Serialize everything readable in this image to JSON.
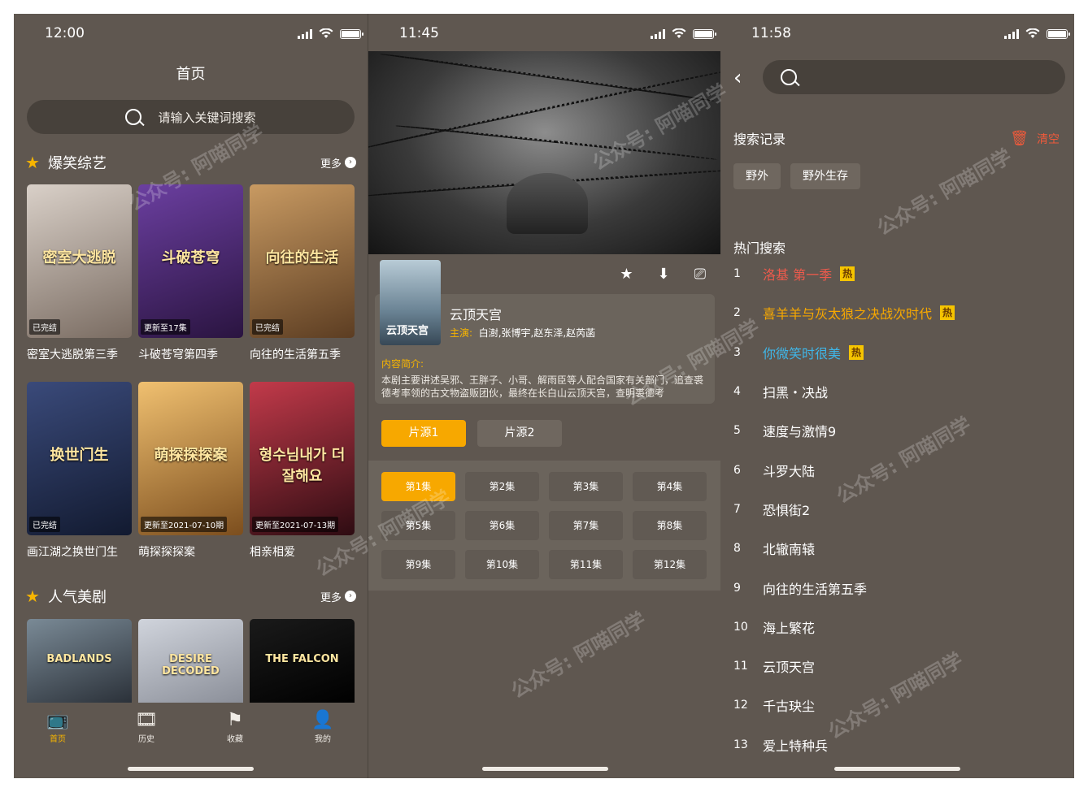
{
  "colors": {
    "bg": "#5f5750",
    "accent": "#f7b500",
    "hot_red": "#ef5a4c",
    "hot_orange": "#f7a800",
    "hot_blue": "#3fb6e8"
  },
  "panel1": {
    "time": "12:00",
    "title": "首页",
    "search_placeholder": "请输入关键词搜索",
    "section1": {
      "name": "爆笑综艺",
      "more": "更多"
    },
    "section2": {
      "name": "人气美剧",
      "more": "更多"
    },
    "cards": [
      {
        "title": "密室大逃脱第三季",
        "badge": "已完结",
        "poster_text": "密室大逃脱",
        "color1": "#d9d0c8",
        "color2": "#7a6c62"
      },
      {
        "title": "斗破苍穹第四季",
        "badge": "更新至17集",
        "poster_text": "斗破苍穹",
        "color1": "#6b3fa0",
        "color2": "#2a1440"
      },
      {
        "title": "向往的生活第五季",
        "badge": "已完结",
        "poster_text": "向往的生活",
        "color1": "#c89a62",
        "color2": "#5c3d22"
      },
      {
        "title": "画江湖之换世门生",
        "badge": "已完结",
        "poster_text": "换世门生",
        "color1": "#3a4a7a",
        "color2": "#121a30"
      },
      {
        "title": "萌探探探案",
        "badge": "更新至2021-07-10期",
        "poster_text": "萌探探探案",
        "color1": "#f0c070",
        "color2": "#7c4e1e"
      },
      {
        "title": "相亲相爱",
        "badge": "更新至2021-07-13期",
        "poster_text": "형수님내가 더잘해요",
        "color1": "#c23a4a",
        "color2": "#2e0c12"
      }
    ],
    "cards2": [
      {
        "poster_text": "BADLANDS",
        "color1": "#7a8a96",
        "color2": "#2a3038"
      },
      {
        "poster_text": "DESIRE DECODED",
        "color1": "#d0d4dc",
        "color2": "#8a8e98"
      },
      {
        "poster_text": "THE FALCON",
        "color1": "#1a1a1a",
        "color2": "#000000"
      }
    ],
    "tabs": [
      {
        "label": "首页",
        "icon": "tv-icon",
        "glyph": "📺"
      },
      {
        "label": "历史",
        "icon": "film-icon",
        "glyph": "🎞"
      },
      {
        "label": "收藏",
        "icon": "flag-icon",
        "glyph": "⚑"
      },
      {
        "label": "我的",
        "icon": "user-icon",
        "glyph": "👤"
      }
    ]
  },
  "panel2": {
    "time": "11:45",
    "drama_title": "云顶天宫",
    "cover_text": "云顶天宫",
    "cast_label": "主演:",
    "cast": "白澍,张博宇,赵东泽,赵芮菡",
    "intro_label": "内容简介:",
    "intro": "本剧主要讲述吴邪、王胖子、小哥、解雨臣等人配合国家有关部门，追查裘德考率领的古文物盗贩团伙，最终在长白山云顶天宫，查明裘德考",
    "sources": [
      "片源1",
      "片源2"
    ],
    "episodes": [
      "第1集",
      "第2集",
      "第3集",
      "第4集",
      "第5集",
      "第6集",
      "第7集",
      "第8集",
      "第9集",
      "第10集",
      "第11集",
      "第12集"
    ],
    "actions": [
      {
        "name": "favorite-star-icon",
        "glyph": "★"
      },
      {
        "name": "download-icon",
        "glyph": "⬇"
      },
      {
        "name": "cast-screen-icon",
        "glyph": "⎚"
      }
    ]
  },
  "panel3": {
    "time": "11:58",
    "history_title": "搜索记录",
    "clear_label": "清空",
    "history": [
      "野外",
      "野外生存"
    ],
    "hot_title": "热门搜索",
    "hot_badge": "热",
    "hot": [
      {
        "rank": "1",
        "name": "洛基 第一季",
        "hot": true,
        "color": "#ef5a4c"
      },
      {
        "rank": "2",
        "name": "喜羊羊与灰太狼之决战次时代",
        "hot": true,
        "color": "#f7a800"
      },
      {
        "rank": "3",
        "name": "你微笑时很美",
        "hot": true,
        "color": "#3fb6e8"
      },
      {
        "rank": "4",
        "name": "扫黑・决战",
        "hot": false,
        "color": "#ffffff"
      },
      {
        "rank": "5",
        "name": "速度与激情9",
        "hot": false,
        "color": "#ffffff"
      },
      {
        "rank": "6",
        "name": "斗罗大陆",
        "hot": false,
        "color": "#ffffff"
      },
      {
        "rank": "7",
        "name": "恐惧街2",
        "hot": false,
        "color": "#ffffff"
      },
      {
        "rank": "8",
        "name": "北辙南辕",
        "hot": false,
        "color": "#ffffff"
      },
      {
        "rank": "9",
        "name": "向往的生活第五季",
        "hot": false,
        "color": "#ffffff"
      },
      {
        "rank": "10",
        "name": "海上繁花",
        "hot": false,
        "color": "#ffffff"
      },
      {
        "rank": "11",
        "name": "云顶天宫",
        "hot": false,
        "color": "#ffffff"
      },
      {
        "rank": "12",
        "name": "千古玦尘",
        "hot": false,
        "color": "#ffffff"
      },
      {
        "rank": "13",
        "name": "爱上特种兵",
        "hot": false,
        "color": "#ffffff"
      }
    ]
  },
  "watermark": "公众号: 阿喵同学"
}
